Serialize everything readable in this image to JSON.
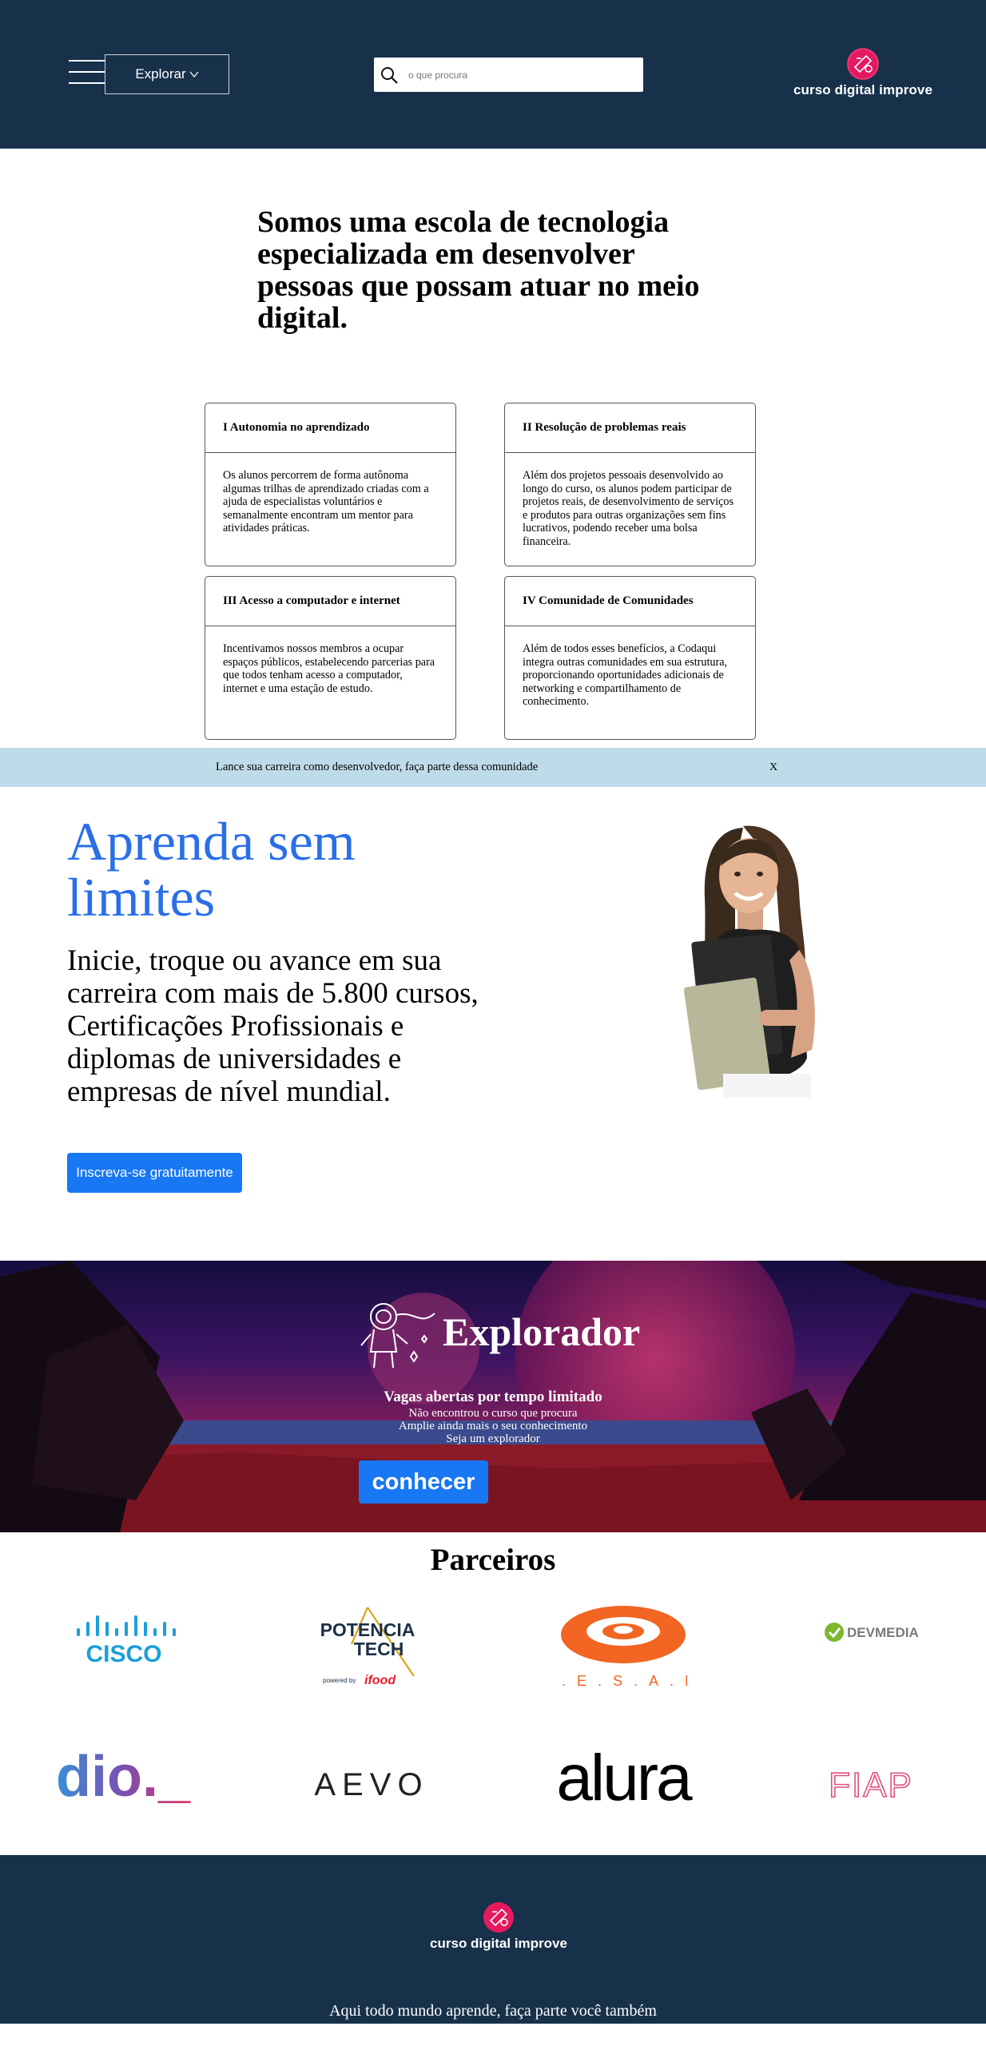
{
  "header": {
    "menu_icon": "hamburger-menu-icon",
    "explorar_label": "Explorar",
    "search_placeholder": "o que procura",
    "search_value": "",
    "brand": "curso digital improve",
    "background": "#17314a"
  },
  "intro": {
    "heading": "Somos uma escola de tecnologia especializada em desenvolver pessoas que possam atuar no meio digital.",
    "cards": [
      {
        "title": "I Autonomia no aprendizado",
        "body": "Os alunos percorrem de forma autônoma algumas trilhas de aprendizado criadas com a ajuda de especialistas voluntários e semanalmente encontram um mentor para atividades práticas."
      },
      {
        "title": "II Resolução de problemas reais",
        "body": "Além dos projetos pessoais desenvolvido ao longo do curso, os alunos podem participar de projetos reais, de desenvolvimento de serviços e produtos para outras organizações sem fins lucrativos, podendo receber uma bolsa financeira."
      },
      {
        "title": "III Acesso a computador e internet",
        "body": "Incentivamos nossos membros a ocupar espaços públicos, estabelecendo parcerias para que todos tenham acesso a computador, internet e uma estação de estudo."
      },
      {
        "title": "IV Comunidade de Comunidades",
        "body": "Além de todos esses benefícios, a Codaqui integra outras comunidades em sua estrutura, proporcionando oportunidades adicionais de networking e compartilhamento de conhecimento."
      }
    ]
  },
  "banner": {
    "text": "Lance sua carreira como desenvolvedor, faça parte dessa comunidade",
    "close": "X",
    "background": "#bedbe9"
  },
  "hero": {
    "title": "Aprenda sem limites",
    "subtitle": "Inicie, troque ou avance em sua carreira com mais de 5.800 cursos, Certificações Profissionais e diplomas de universidades e empresas de nível mundial.",
    "cta": "Inscreva-se gratuitamente",
    "title_color": "#2a6ee8",
    "cta_color": "#1877f2"
  },
  "explorador": {
    "title": "Explorador",
    "headline": "Vagas abertas por tempo limitado",
    "lines": [
      "Não encontrou o curso que procura",
      "Amplie ainda mais o seu conhecimento",
      "Seja um explorador"
    ],
    "button": "conhecer"
  },
  "parceiros": {
    "title": "Parceiros",
    "logos": [
      {
        "name": "cisco",
        "text": "CISCO"
      },
      {
        "name": "potencia-tech",
        "line1": "POTENCIA",
        "line2": "TECH",
        "powered": "powered by",
        "brand": "ifood"
      },
      {
        "name": "cesar",
        "text": "C.E.S.A.R"
      },
      {
        "name": "devmedia",
        "text": "DEVMEDIA"
      },
      {
        "name": "dio",
        "text": "dio._"
      },
      {
        "name": "aevo",
        "text": "AEVO"
      },
      {
        "name": "alura",
        "text": "alura"
      },
      {
        "name": "fiap",
        "text": "FIAP"
      }
    ]
  },
  "footer": {
    "brand": "curso digital improve",
    "tagline": "Aqui todo mundo aprende, faça parte você também"
  }
}
